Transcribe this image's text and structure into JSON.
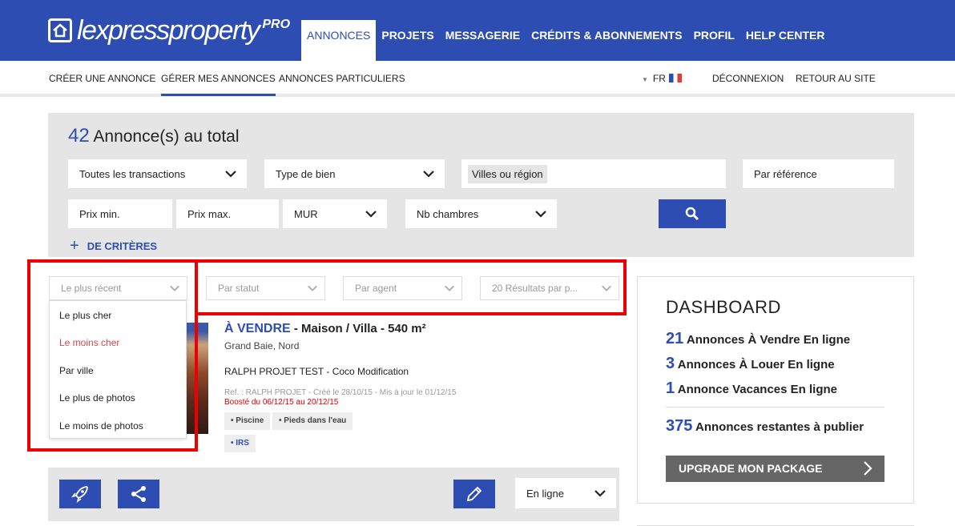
{
  "header": {
    "logo_text": "lexpressproperty",
    "logo_badge": "PRO",
    "nav": [
      {
        "label": "ANNONCES",
        "active": true
      },
      {
        "label": "PROJETS"
      },
      {
        "label": "MESSAGERIE"
      },
      {
        "label": "CRÉDITS & ABONNEMENTS"
      },
      {
        "label": "PROFIL"
      },
      {
        "label": "HELP CENTER"
      }
    ]
  },
  "subnav": {
    "items": [
      {
        "label": "CRÉER UNE ANNONCE"
      },
      {
        "label": "GÉRER MES ANNONCES",
        "active": true
      },
      {
        "label": "ANNONCES PARTICULIERS"
      }
    ],
    "lang": "FR",
    "logout": "DÉCONNEXION",
    "back": "RETOUR AU SITE"
  },
  "search": {
    "total_count": "42",
    "total_label": "Annonce(s) au total",
    "transactions": "Toutes les transactions",
    "property_type": "Type de bien",
    "cities": "Villes ou région",
    "reference": "Par référence",
    "price_min": "Prix min.",
    "price_max": "Prix max.",
    "currency": "MUR",
    "bedrooms": "Nb chambres",
    "more_criteria": "DE CRITÈRES"
  },
  "filters": {
    "sort": "Le plus récent",
    "status": "Par statut",
    "agent": "Par agent",
    "per_page": "20 Résultats par p..."
  },
  "sort_options": [
    {
      "label": "Le plus cher"
    },
    {
      "label": "Le moins cher",
      "highlighted": true
    },
    {
      "label": "Par ville"
    },
    {
      "label": "Le plus de photos"
    },
    {
      "label": "Le moins de photos"
    }
  ],
  "listing": {
    "transaction": "À VENDRE",
    "title": "- Maison / Villa - 540 m²",
    "location": "Grand Baie, Nord",
    "project": "RALPH PROJET TEST - Coco Modification",
    "ref": "Ref. : RALPH PROJET - Créé le 28/10/15 - Mis à jour le 01/12/15",
    "boost": "Boosté du 06/12/15 au 20/12/15",
    "features": [
      "• Piscine",
      "• Pieds dans l'eau"
    ],
    "irs": "• IRS",
    "status": "En ligne"
  },
  "dashboard": {
    "title": "DASHBOARD",
    "rows": [
      {
        "n": "21",
        "label": "Annonces À Vendre En ligne"
      },
      {
        "n": "3",
        "label": "Annonces À Louer En ligne"
      },
      {
        "n": "1",
        "label": "Annonce Vacances En ligne"
      }
    ],
    "remaining_n": "375",
    "remaining_label": "Annonces restantes à publier",
    "upgrade": "UPGRADE MON PACKAGE"
  },
  "colors": {
    "brand": "#2d4db3",
    "highlight_red": "#e00000",
    "accent_red": "#d64646"
  }
}
